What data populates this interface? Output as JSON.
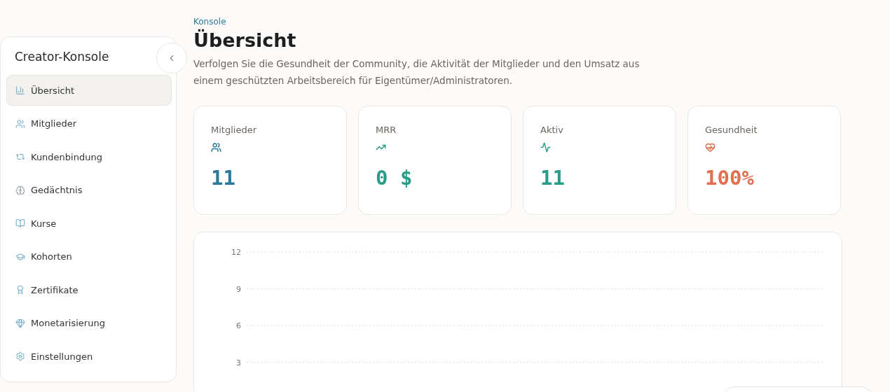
{
  "sidebar": {
    "title": "Creator-Konsole",
    "items": [
      {
        "label": "Übersicht",
        "selected": true
      },
      {
        "label": "Mitglieder",
        "selected": false
      },
      {
        "label": "Kundenbindung",
        "selected": false
      },
      {
        "label": "Gedächtnis",
        "selected": false
      },
      {
        "label": "Kurse",
        "selected": false
      },
      {
        "label": "Kohorten",
        "selected": false
      },
      {
        "label": "Zertifikate",
        "selected": false
      },
      {
        "label": "Monetarisierung",
        "selected": false
      },
      {
        "label": "Einstellungen",
        "selected": false
      }
    ]
  },
  "header": {
    "breadcrumb": "Konsole",
    "title": "Übersicht",
    "description": "Verfolgen Sie die Gesundheit der Community, die Aktivität der Mitglieder und den Umsatz aus einem geschützten Arbeitsbereich für Eigentümer/Administratoren."
  },
  "stats": [
    {
      "label": "Mitglieder",
      "value": "11",
      "color": "#2b7a9b"
    },
    {
      "label": "MRR",
      "value": "0 $",
      "color": "#2a9d8a"
    },
    {
      "label": "Aktiv",
      "value": "11",
      "color": "#2a9d8a"
    },
    {
      "label": "Gesundheit",
      "value": "100%",
      "color": "#e07050"
    }
  ],
  "chart": {
    "axis_labels": [
      "12",
      "9",
      "6",
      "3"
    ]
  }
}
